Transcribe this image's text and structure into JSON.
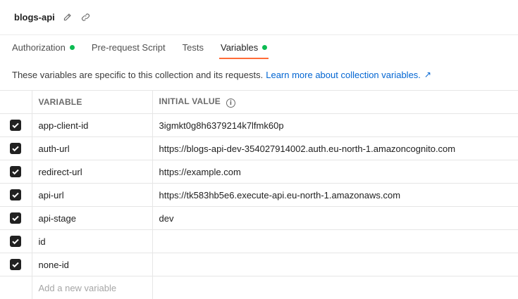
{
  "collection": {
    "name": "blogs-api"
  },
  "tabs": [
    {
      "label": "Authorization",
      "dot": true,
      "active": false
    },
    {
      "label": "Pre-request Script",
      "dot": false,
      "active": false
    },
    {
      "label": "Tests",
      "dot": false,
      "active": false
    },
    {
      "label": "Variables",
      "dot": true,
      "active": true
    }
  ],
  "description": {
    "text": "These variables are specific to this collection and its requests.",
    "link": "Learn more about collection variables."
  },
  "table": {
    "headers": {
      "variable": "VARIABLE",
      "initial_value": "INITIAL VALUE"
    },
    "rows": [
      {
        "checked": true,
        "variable": "app-client-id",
        "value": "3igmkt0g8h6379214k7lfmk60p"
      },
      {
        "checked": true,
        "variable": "auth-url",
        "value": "https://blogs-api-dev-354027914002.auth.eu-north-1.amazoncognito.com"
      },
      {
        "checked": true,
        "variable": "redirect-url",
        "value": "https://example.com"
      },
      {
        "checked": true,
        "variable": "api-url",
        "value": "https://tk583hb5e6.execute-api.eu-north-1.amazonaws.com"
      },
      {
        "checked": true,
        "variable": "api-stage",
        "value": "dev"
      },
      {
        "checked": true,
        "variable": "id",
        "value": ""
      },
      {
        "checked": true,
        "variable": "none-id",
        "value": ""
      }
    ],
    "new_variable_placeholder": "Add a new variable"
  },
  "colors": {
    "accent": "#ff6c37",
    "status_dot": "#0cbb52",
    "link": "#0265d2"
  },
  "icons": [
    "edit-pencil-icon",
    "link-icon",
    "info-icon",
    "external-arrow-icon",
    "checkbox-check-icon"
  ]
}
